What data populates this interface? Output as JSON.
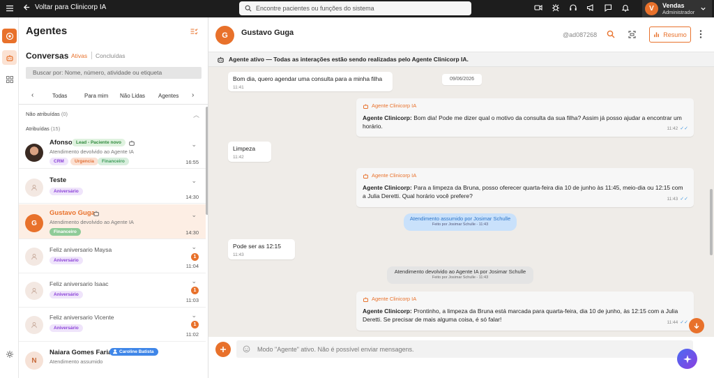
{
  "topbar": {
    "back_label": "Voltar para Clinicorp IA",
    "search_placeholder": "Encontre pacientes ou funções do sistema",
    "icons": [
      "video-icon",
      "bug-icon",
      "headset-icon",
      "megaphone-icon",
      "chat-icon",
      "bell-icon"
    ],
    "user": {
      "initial": "V",
      "name": "Vendas",
      "role": "Administrador"
    }
  },
  "sidebar": {
    "title": "Agentes",
    "section": "Conversas",
    "tab_active": "Ativas",
    "tab_done": "Concluídas",
    "search_placeholder": "Buscar por: Nome, número, atividade ou etiqueta",
    "filters": [
      "Todas",
      "Para mim",
      "Não Lidas",
      "Agentes"
    ],
    "groups": {
      "unassigned": {
        "label": "Não atribuídas",
        "count": "(0)"
      },
      "assigned": {
        "label": "Atribuídas",
        "count": "(15)"
      }
    },
    "conversations": [
      {
        "name": "Afonso",
        "lead": "Lead - Paciente novo",
        "sub": "Atendimento devolvido ao Agente IA",
        "tags": [
          "CRM",
          "Urgencia",
          "Financeiro"
        ],
        "time": "16:55"
      },
      {
        "name": "Teste",
        "tags": [
          "Aniversário"
        ],
        "time": "14:30"
      },
      {
        "name": "Gustavo Guga",
        "initial": "G",
        "sub": "Atendimento devolvido ao Agente IA",
        "tags": [
          "Financeiro"
        ],
        "time": "14:30"
      },
      {
        "name": "Feliz aniversario Maysa",
        "tags": [
          "Aniversário"
        ],
        "time": "11:04",
        "badge": "1"
      },
      {
        "name": "Feliz aniversario Isaac",
        "tags": [
          "Aniversário"
        ],
        "time": "11:03",
        "badge": "1"
      },
      {
        "name": "Feliz aniversario Vicente",
        "tags": [
          "Aniversário"
        ],
        "time": "11:02",
        "badge": "1"
      },
      {
        "name": "Naiara Gomes Farias",
        "initial": "N",
        "assignee": "Caroline Batista",
        "sub": "Atendimento assumido"
      }
    ]
  },
  "chat": {
    "contact_initial": "G",
    "contact_name": "Gustavo Guga",
    "contact_id": "@ad087268",
    "resumo_label": "Resumo",
    "banner": "Agente ativo — Todas as interações estão sendo realizadas pelo Agente Clinicorp IA.",
    "date": "09/06/2026",
    "ia_label": "Agente Clinicorp IA",
    "ia_prefix": "Agente Clinicorp:",
    "messages": [
      {
        "text": "Bom dia, quero agendar uma consulta para a minha filha",
        "time": "11:41"
      },
      {
        "text": "Bom dia! Pode me dizer qual o motivo da consulta da sua filha? Assim já posso ajudar a encontrar um horário.",
        "time": "11:42"
      },
      {
        "text": "Limpeza",
        "time": "11:42"
      },
      {
        "text": "Para a limpeza da Bruna, posso oferecer quarta-feira dia 10 de junho às 11:45, meio-dia ou 12:15 com a Julia Deretti. Qual horário você prefere?",
        "time": "11:43"
      },
      {
        "text": "Pode ser as 12:15",
        "time": "11:43"
      },
      {
        "text": "Prontinho, a limpeza da Bruna está marcada para quarta-feira, dia 10 de junho, às 12:15 com a Julia Deretti. Se precisar de mais alguma coisa, é só falar!",
        "time": "11:44"
      }
    ],
    "system_assumed": {
      "text": "Atendimento assumido por Josimar Schulle",
      "sub": "Feito por Josimar Schulle - 11:43"
    },
    "system_returned": {
      "text": "Atendimento devolvido ao Agente IA por Josimar Schulle",
      "sub": "Feito por Josimar Schulle - 11:43"
    },
    "composer_placeholder": "Modo \"Agente\" ativo. Não é possível enviar mensagens."
  },
  "colors": {
    "accent": "#e8712b",
    "topbar": "#1d1d1d",
    "chat_bg": "#efece8"
  }
}
